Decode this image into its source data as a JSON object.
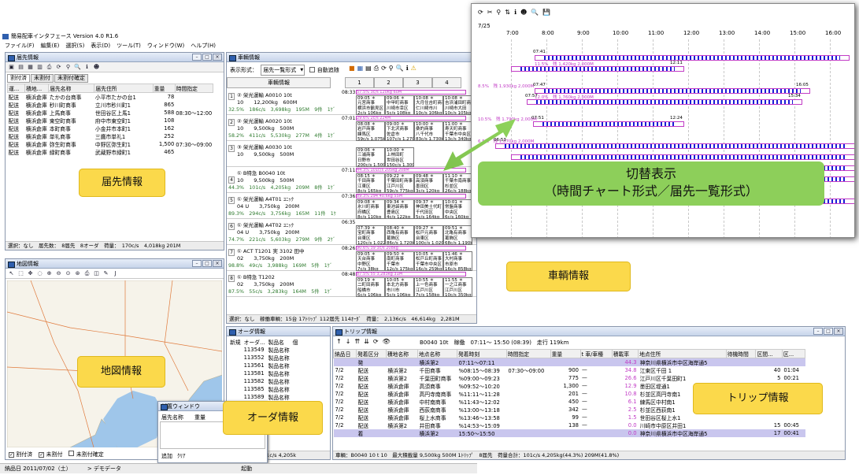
{
  "app": {
    "title": "簡易配車インタフェース Version 4.0 R1.6",
    "menu": [
      "ファイル(F)",
      "編集(E)",
      "選択(S)",
      "表示(D)",
      "ツール(T)",
      "ウィンドウ(W)",
      "ヘルプ(H)"
    ],
    "status_date": "納品日 2011/07/02（土）",
    "status_demo": "デモデータ",
    "status_start": "起動"
  },
  "dest": {
    "title": "届先情報",
    "tabs": [
      "割付済",
      "未割付",
      "未割付確定"
    ],
    "headers": [
      "運...",
      "積地...",
      "届先名称",
      "届先住所",
      "重量",
      "時間指定"
    ],
    "rows": [
      [
        "配送",
        "横浜倉庫",
        "たかの台商事",
        "小平市たかの台1",
        "78",
        ""
      ],
      [
        "配送",
        "横浜倉庫",
        "秒川町商事",
        "立川市秒川町1",
        "865",
        ""
      ],
      [
        "配送",
        "横浜倉庫",
        "上馬商事",
        "世田谷区上馬1",
        "588",
        "08:30〜12:00"
      ],
      [
        "配送",
        "横浜倉庫",
        "東空町商事",
        "府中市東空町1",
        "108",
        ""
      ],
      [
        "配送",
        "横浜倉庫",
        "本町商事",
        "小金井市本町1",
        "162",
        ""
      ],
      [
        "配送",
        "横浜倉庫",
        "単礼商事",
        "三鷹市単礼1",
        "252",
        ""
      ],
      [
        "配送",
        "横浜倉庫",
        "弥生町商事",
        "中野区弥生町1",
        "1,500",
        "07:30〜09:00"
      ],
      [
        "配送",
        "横浜倉庫",
        "緑町商事",
        "武蔵野市緑町1",
        "465",
        ""
      ]
    ],
    "status": "選択：なし　届先数：　8届先　8オーダ　荷量：　170c/s　4,018kg 201M"
  },
  "vehicle": {
    "title": "車輌情報",
    "display_mode_label": "表示形式：",
    "display_mode": "届先一覧形式",
    "auto_scroll": "自動追随",
    "header_label": "車輌情報",
    "cols": [
      "1",
      "2",
      "3",
      "4"
    ],
    "rows": [
      {
        "no": "1",
        "name": "② 栄光運輸 A0010 10t",
        "line2": "10　　12,200kg　600M",
        "line3": "32.5%　186c/s　3,698kg　195M　9件　1ｹﾞ"
      },
      {
        "no": "2",
        "name": "② 栄光運輸 A0020 10t",
        "line2": "10　　9,500kg　500M",
        "line3": "58.2%　411c/s　5,530kg　277M　4件　1ｹﾞ"
      },
      {
        "no": "3",
        "name": "③ 栄光運輸 A0030 10t",
        "line2": "10　　9,500kg　500M",
        "line3": ""
      },
      {
        "no": "4",
        "name": "① B特急 B0040 10t",
        "line2": "10　　9,500kg　500M",
        "line3": "44.3%　101c/s　4,205kg　209M　8件　1ｹﾞ"
      },
      {
        "no": "5",
        "name": "① 栄光運輸 A4T01 ﾕﾆｯｸ",
        "line2": "04 U　　3,750kg　200M",
        "line3": "89.3%　294c/s　3,756kg　165M　11件　1ｹ"
      },
      {
        "no": "6",
        "name": "① 栄光運輸 A4T02 ﾕﾆｯｸ",
        "line2": "04 U　　3,750kg　200M",
        "line3": "74.7%　221c/s　5,603kg　279M　9件　2ｹﾞ"
      },
      {
        "no": "7",
        "name": "① ACT T1201 実 3102 田中",
        "line2": "02　　3,750kg　200M",
        "line3": "98.8%　49c/s　3,988kg　169M　5件　1ｹﾞ"
      },
      {
        "no": "8",
        "name": "① B特急 T1202",
        "line2": "02　　3,750kg　200M",
        "line3": "87.5%　55c/s　3,283kg　164M　5件　1ｹﾞ"
      }
    ],
    "status": "選択：なし　稼働車輌：15台 17ﾄﾘｯﾌﾟ 112届先 114ｵｰﾀﾞ　荷量：　2,136c/s　46,614kg　2,281M",
    "times": [
      "08:33",
      "07:01",
      "",
      "07:11",
      "07:36",
      "06:35",
      "08:26",
      "08:48"
    ],
    "cells": [
      [
        [
          "09:05 ＊",
          "元宮商事",
          "横浜市鶴見区",
          "2c/s 106kg"
        ],
        [
          "09:06 ＊",
          "中甲町商事",
          "川崎市幸区",
          "5c/s 108kg"
        ],
        [
          "10:08 ＊",
          "大月住吉町商事",
          "仁川崎市川",
          "10c/s 106kg"
        ],
        [
          "10:08 ＊",
          "吉浜浦田町商事",
          "川崎市大田",
          "10c/s 105kg"
        ]
      ],
      [
        [
          "08:08 ＊",
          "岩戸商事",
          "練馬区",
          "59c/s 1,075kg"
        ],
        [
          "09:00 ＊",
          "下北沢商事",
          "佐倉市",
          "107c/s 1,270kg"
        ],
        [
          "10:00 ＊",
          "桑的商事",
          "八千代市",
          "83c/s 1,730kg"
        ],
        [
          "11:00 ＊",
          "寿天町商事",
          "千葉市中央区",
          "13c/s 340kg"
        ]
      ],
      [
        [
          "09:06 ＊",
          "三浦商事",
          "日野市",
          "200c/s 1,500kg"
        ],
        [
          "10:00 ＊",
          "上林田町",
          "世田谷区",
          "150c/s 1,300kg"
        ],
        [
          "",
          "",
          "",
          ""
        ],
        [
          "",
          "",
          "",
          ""
        ]
      ],
      [
        [
          "08:15 ＊",
          "千田商事",
          "江東区",
          "8c/s 165kg"
        ],
        [
          "09:22 ＊",
          "千葉田町商事",
          "江戸川区",
          "59c/s 775kg"
        ],
        [
          "09:48 ＊",
          "高須商事",
          "墨田区",
          "3c/s 120kg"
        ],
        [
          "11:10 ＊",
          "千葉市南商事",
          "杉並区",
          "26c/s 188kg"
        ]
      ],
      [
        [
          "09:08 ＊",
          "氷川町商事",
          "府橋区",
          "8c/s 110kg"
        ],
        [
          "09:34 ＊",
          "東池袋商事",
          "豊島区",
          "4c/s 122kg"
        ],
        [
          "09:37 ＊",
          "神田美土代町",
          "千代田区",
          "5c/s 164kg"
        ],
        [
          "10:01 ＊",
          "常盤商事",
          "中央区",
          "6c/s 160kg"
        ]
      ],
      [
        [
          "07:39 ＊",
          "宝町商事",
          "台東区",
          "120c/s 1,022kg"
        ],
        [
          "08:40 ＊",
          "西亀有商事",
          "葛飾区",
          "86c/s 1,720kg"
        ],
        [
          "09:27 ＊",
          "松戸元商事",
          "台東区",
          "100c/s 1,020kg"
        ],
        [
          "09:51 ＊",
          "北亀有商事",
          "葛飾区",
          "68c/s 1,190kg"
        ]
      ],
      [
        [
          "09:05 ＊",
          "天台商事",
          "中野区",
          "7c/s 38kg"
        ],
        [
          "09:50 ＊",
          "南町商事",
          "千葉市",
          "12c/s 175kg"
        ],
        [
          "10:05 ＊",
          "松戸丘町商事",
          "千葉市中央区",
          "16c/s 259kg"
        ],
        [
          "11:46 ＊",
          "大村商事",
          "市原市",
          "16c/s 858kg"
        ]
      ],
      [
        [
          "09:19 ＊",
          "二町田商事",
          "船橋市",
          "6c/s 106kg"
        ],
        [
          "10:05 ＊",
          "本北方商事",
          "市川市",
          "5c/s 106kg"
        ],
        [
          "10:55 ＊",
          "上一色商事",
          "江戸川区",
          "7c/s 158kg"
        ],
        [
          "11:55 ＊",
          "一之江商事",
          "江戸川区",
          "10c/s 350kg"
        ]
      ]
    ],
    "segments": [
      "57.5% 3c/s 120kg 60M",
      "29.6% 2c/s 224M",
      "",
      "44.3% 101c/s 205kg 208M",
      "89.3% 294 40.6kg 55M",
      "",
      "90.6% 39 3c/s 208kg",
      "87.5% 55 3,283kg 31M"
    ],
    "extra": [
      [
        "千葉市中央区",
        "練馬区",
        "南区",
        "船橋市",
        "北区",
        "江戸川区",
        "花見川区",
        "千葉市",
        "千葉市中央区"
      ],
      [
        "千葉倉庫",
        "船橋市",
        "船橋市",
        "船橋市"
      ],
      [
        "211c/s 2,29",
        "200c/s 1,500",
        "10c/s 350kg",
        "10c/s 350kg"
      ]
    ],
    "extra_time": [
      "12:37",
      "15:23"
    ]
  },
  "timechart": {
    "date": "7/25",
    "times": [
      "7:00",
      "8:00",
      "9:00",
      "10:00",
      "11:00",
      "12:00",
      "13:00",
      "14:00",
      "15:00",
      "16:00"
    ],
    "bars": [
      {
        "start": "07:41",
        "label": "11.5%　残 1,420kg 2,000M"
      },
      {
        "start": "",
        "label": "",
        "end": "12:11"
      },
      {
        "start": "",
        "label": "8.5%　残 1,930kg 2,000M"
      },
      {
        "start": "07:47",
        "label": "12.0%　残 1,760kg 2,000M",
        "end": "16:05"
      },
      {
        "start": "07:57",
        "label": "",
        "end": "15:34"
      },
      {
        "start": "",
        "label": "10.5%　残 1,790kg 2,000M"
      },
      {
        "start": "07:51",
        "label": "",
        "end": "12:24"
      },
      {
        "start": "",
        "label": "6.5%　残 1,870kg 2,000M"
      },
      {
        "start": "06:53",
        "label": ""
      },
      {
        "start": "",
        "label": ""
      },
      {
        "start": "",
        "label": ""
      },
      {
        "start": "",
        "label": ""
      },
      {
        "start": "",
        "label": "10.3%　残 1,750kg 1,950M"
      },
      {
        "start": "06:54",
        "label": ""
      }
    ]
  },
  "callout": {
    "line1": "切替表示",
    "line2": "（時間チャート形式／届先一覧形式）"
  },
  "map": {
    "title": "地図情報",
    "checks": [
      "割付済",
      "未割付",
      "未割付確定"
    ]
  },
  "order": {
    "title": "オーダ情報",
    "headers": [
      "新規",
      "オーダ...",
      "製品名",
      "個"
    ],
    "rows": [
      [
        "113549",
        "製品名称"
      ],
      [
        "113552",
        "製品名称"
      ],
      [
        "113561",
        "製品名称"
      ],
      [
        "113581",
        "製品名称"
      ],
      [
        "113582",
        "製品名称"
      ],
      [
        "113585",
        "製品名称"
      ],
      [
        "113589",
        "製品名称"
      ],
      [
        "113593",
        "製品名称"
      ]
    ]
  },
  "kasou": {
    "title": "仮置ウィンドウ",
    "headers": [
      "届先名称",
      "重量"
    ],
    "buttons": [
      "追加",
      "ｸﾘｱ"
    ]
  },
  "trip": {
    "title": "トリップ情報",
    "info": "B0040 10t　稼働　07:11〜 15:50 (08:39)　走行 119km",
    "headers": [
      "納品日",
      "発着区分",
      "積地名称",
      "地点名称",
      "発着時刻",
      "時間指定",
      "重量",
      "t 車/車種",
      "積載率",
      "地点住所",
      "待機時間",
      "区間...",
      "区..."
    ],
    "rows": [
      [
        "",
        "発",
        "",
        "横浜第2",
        "07:11〜07:11",
        "",
        "",
        "",
        "44.3",
        "神奈川県横浜市中区海岸通5",
        "",
        "",
        ""
      ],
      [
        "7/2",
        "配送",
        "横浜第2",
        "千田商事",
        "%08:15〜08:39",
        "07:30〜09:00",
        "900",
        "—",
        "34.8",
        "江東区千田 1",
        "",
        "40",
        "01:04"
      ],
      [
        "7/2",
        "配送",
        "横浜第2",
        "千葉田町商事",
        "%09:00〜09:23",
        "",
        "775",
        "—",
        "26.6",
        "江戸川区千葉田町1",
        "",
        "5",
        "00:21"
      ],
      [
        "7/2",
        "配送",
        "横浜倉庫",
        "高須商事",
        "%09:52〜10:20",
        "",
        "1,300",
        "—",
        "12.9",
        "墨田区堤通1",
        "",
        "",
        ""
      ],
      [
        "7/2",
        "配送",
        "横浜倉庫",
        "高円寺南商事",
        "%11:11〜11:28",
        "",
        "201",
        "—",
        "10.8",
        "杉並区高円寺南1",
        "",
        "",
        ""
      ],
      [
        "7/2",
        "配送",
        "横浜倉庫",
        "中村南商事",
        "%11:43〜12:02",
        "",
        "450",
        "—",
        "6.1",
        "練馬区中村南1",
        "",
        "",
        ""
      ],
      [
        "7/2",
        "配送",
        "横浜倉庫",
        "西荻南商事",
        "%13:00〜13:18",
        "",
        "342",
        "—",
        "2.5",
        "杉並区西荻南1",
        "",
        "",
        ""
      ],
      [
        "7/2",
        "配送",
        "横浜倉庫",
        "桜上水商事",
        "%13:46〜13:58",
        "",
        "99",
        "—",
        "1.5",
        "世田谷区桜上水1",
        "",
        "",
        ""
      ],
      [
        "7/2",
        "配送",
        "横浜第2",
        "井田商事",
        "%14:53〜15:09",
        "",
        "138",
        "—",
        "0.0",
        "川崎市中原区井田1",
        "",
        "15",
        "00:45"
      ],
      [
        "",
        "着",
        "",
        "横浜第2",
        "15:50〜15:50",
        "",
        "",
        "",
        "0.0",
        "神奈川県横浜市中区海岸通5",
        "",
        "17",
        "00:41"
      ]
    ],
    "status": "車輌：B0040 10 t 10　最大積載量 9,500kg 500M 1ﾄﾘｯﾌﾟ　8届先　荷量合計：101c/s 4,205kg(44.3%) 209M(41.8%)"
  },
  "order_status": "選択：なし　101c/s 4,205k",
  "labels": {
    "dest": "届先情報",
    "vehicle": "車輌情報",
    "map": "地図情報",
    "order": "オーダ情報",
    "trip": "トリップ情報"
  },
  "colors": {
    "label_bg": "#fbd94b",
    "callout_bg": "#8dcf5a",
    "pink": "#c23cc6",
    "blue": "#1b1bd8",
    "trip_highlight": "#c9c6ee"
  }
}
